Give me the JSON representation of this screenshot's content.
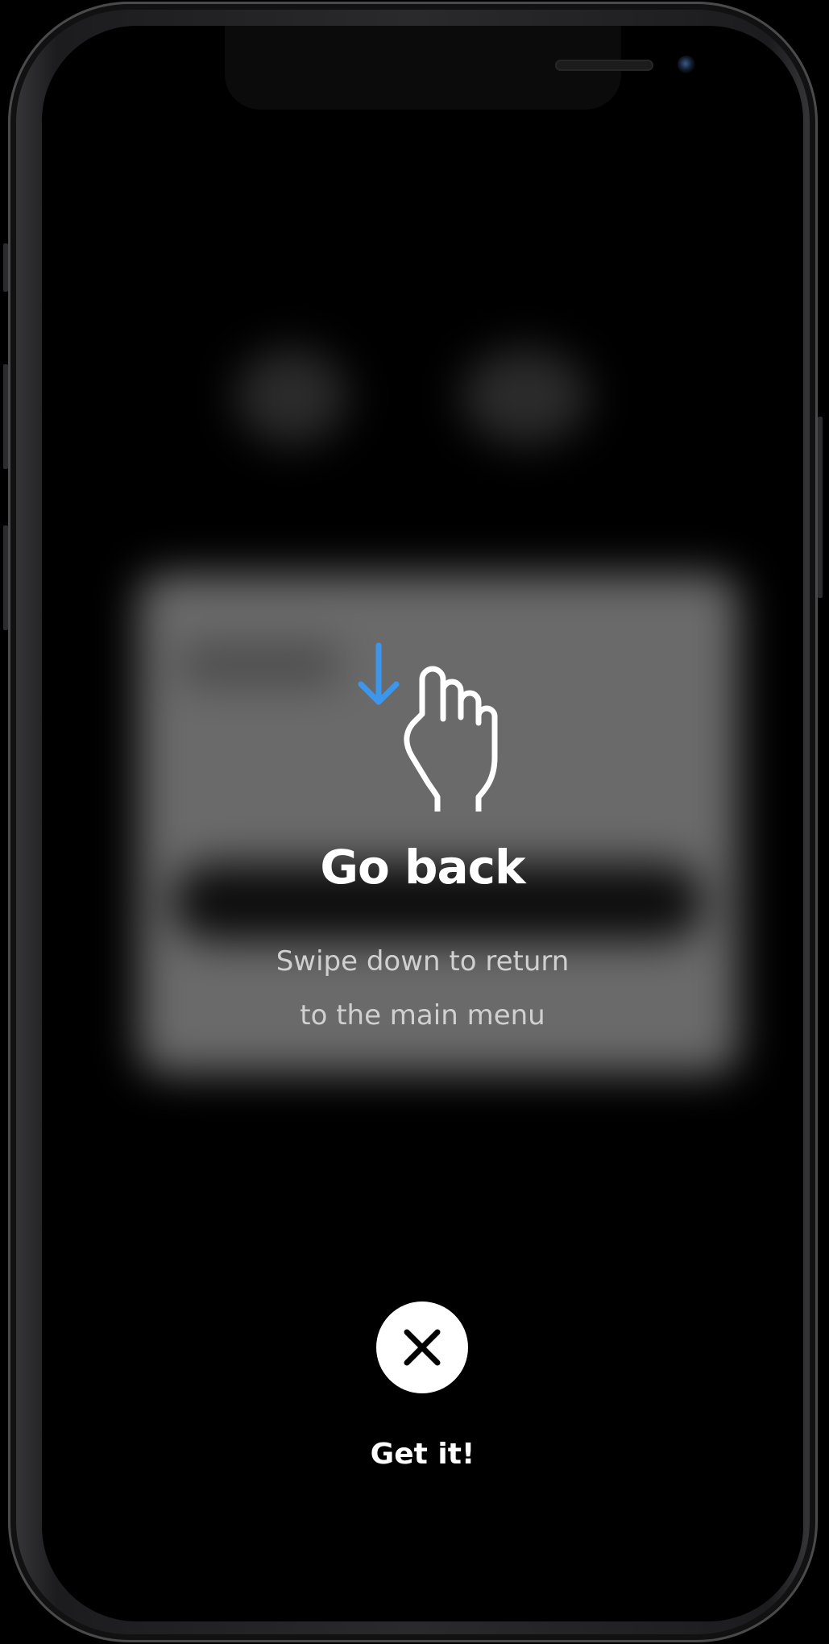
{
  "tutorial": {
    "title": "Go back",
    "description_line1": "Swipe down to return",
    "description_line2": "to the main menu",
    "dismiss_label": "Get it!"
  },
  "colors": {
    "accent_arrow": "#3d96ee",
    "text_primary": "#ffffff",
    "text_secondary": "#d0d0d0",
    "background": "#000000"
  },
  "icons": {
    "gesture": "swipe-down-hand-icon",
    "arrow": "arrow-down-icon",
    "dismiss": "close-icon"
  }
}
